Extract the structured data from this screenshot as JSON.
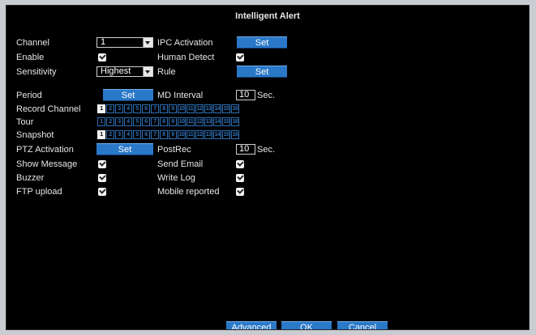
{
  "title": "Intelligent Alert",
  "labels": {
    "channel": "Channel",
    "enable": "Enable",
    "sensitivity": "Sensitivity",
    "ipc_activation": "IPC Activation",
    "human_detect": "Human Detect",
    "rule": "Rule",
    "period": "Period",
    "md_interval": "MD Interval",
    "record_channel": "Record Channel",
    "tour": "Tour",
    "snapshot": "Snapshot",
    "ptz_activation": "PTZ Activation",
    "postrec": "PostRec",
    "show_message": "Show Message",
    "send_email": "Send Email",
    "buzzer": "Buzzer",
    "write_log": "Write Log",
    "ftp_upload": "FTP upload",
    "mobile_reported": "Mobile reported",
    "sec": "Sec."
  },
  "values": {
    "channel": "1",
    "sensitivity": "Highest",
    "md_interval": "10",
    "postrec": "10"
  },
  "buttons": {
    "set": "Set",
    "advanced": "Advanced",
    "ok": "OK",
    "cancel": "Cancel"
  },
  "channel_rows": {
    "record_channel": {
      "labels": [
        "1",
        "2",
        "3",
        "4",
        "5",
        "6",
        "7",
        "8",
        "9",
        "10",
        "11",
        "12",
        "13",
        "14",
        "15",
        "16"
      ],
      "selected": [
        true,
        false,
        false,
        false,
        false,
        false,
        false,
        false,
        false,
        false,
        false,
        false,
        false,
        false,
        false,
        false
      ]
    },
    "tour": {
      "labels": [
        "1",
        "2",
        "3",
        "4",
        "5",
        "6",
        "7",
        "8",
        "9",
        "10",
        "11",
        "12",
        "13",
        "14",
        "15",
        "16"
      ],
      "selected": [
        false,
        false,
        false,
        false,
        false,
        false,
        false,
        false,
        false,
        false,
        false,
        false,
        false,
        false,
        false,
        false
      ]
    },
    "snapshot": {
      "labels": [
        "1",
        "2",
        "3",
        "4",
        "5",
        "6",
        "7",
        "8",
        "9",
        "10",
        "11",
        "12",
        "13",
        "14",
        "15",
        "16"
      ],
      "selected": [
        true,
        false,
        false,
        false,
        false,
        false,
        false,
        false,
        false,
        false,
        false,
        false,
        false,
        false,
        false,
        false
      ]
    }
  },
  "checkboxes": {
    "enable": true,
    "human_detect": true,
    "show_message": true,
    "send_email": true,
    "buzzer": true,
    "write_log": true,
    "ftp_upload": true,
    "mobile_reported": true
  },
  "colors": {
    "button": "#2a78c8",
    "channel_outline": "#2d6fb5",
    "background": "#000000"
  }
}
